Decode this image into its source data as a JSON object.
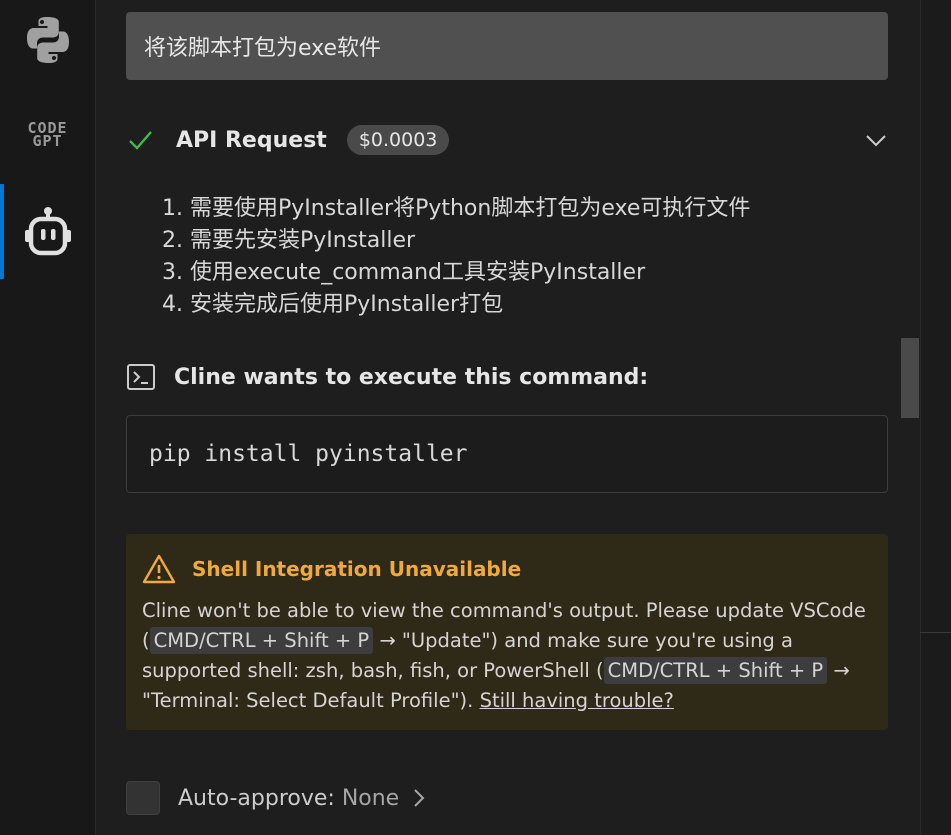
{
  "activity_bar": {
    "items": [
      {
        "name": "python-icon"
      },
      {
        "name": "codegpt-icon",
        "text": "CODE GPT"
      },
      {
        "name": "cline-robot-icon",
        "active": true
      }
    ]
  },
  "chat": {
    "user_message": "将该脚本打包为exe软件",
    "api_request": {
      "status_icon": "check-icon",
      "title": "API Request",
      "cost": "$0.0003",
      "expand_icon": "chevron-down-icon"
    },
    "thinking_steps": [
      "1. 需要使用PyInstaller将Python脚本打包为exe可执行文件",
      "2. 需要先安装PyInstaller",
      "3. 使用execute_command工具安装PyInstaller",
      "4. 安装完成后使用PyInstaller打包"
    ],
    "command": {
      "icon": "terminal-icon",
      "title": "Cline wants to execute this command:",
      "code": "pip install pyinstaller"
    },
    "warning": {
      "icon": "warning-icon",
      "title": "Shell Integration Unavailable",
      "body_1": "Cline won't be able to view the command's output. Please update VSCode (",
      "kbd_1": "CMD/CTRL + Shift + P",
      "body_2": " → \"Update\") and make sure you're using a supported shell: zsh, bash, fish, or PowerShell (",
      "kbd_2": "CMD/CTRL + Shift + P",
      "body_3": " → \"Terminal: Select Default Profile\"). ",
      "link": "Still having trouble?"
    },
    "auto_approve": {
      "label": "Auto-approve:",
      "value": " None",
      "icon": "chevron-right-icon"
    }
  },
  "colors": {
    "accent": "#0078d4",
    "warning": "#f2a93b",
    "success": "#3fb950"
  }
}
